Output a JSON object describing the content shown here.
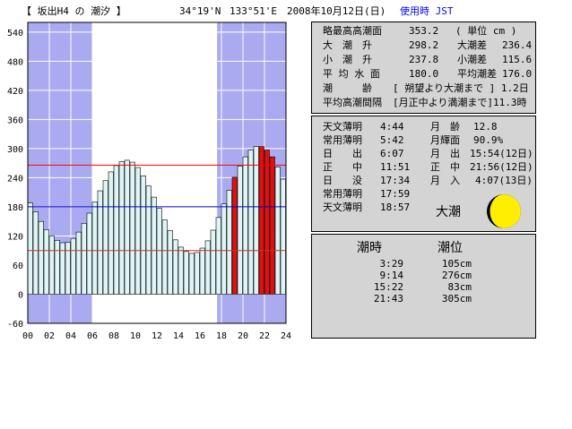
{
  "header": {
    "title": "【 坂出H4 の 潮汐 】",
    "lat": "34°19'N",
    "lon": "133°51'E",
    "date": "2008年10月12日(日)",
    "timezone": "使用時 JST"
  },
  "info": {
    "rows": [
      {
        "label": "略最高高潮面",
        "value": "353.2",
        "extra": "( 単位 cm )"
      },
      {
        "label": "大　潮　升",
        "value": "298.2",
        "label2": "大潮差",
        "value2": "236.4"
      },
      {
        "label": "小　潮　升",
        "value": "237.8",
        "label2": "小潮差",
        "value2": "115.6"
      },
      {
        "label": "平 均 水 面",
        "value": "180.0",
        "label2": "平均潮差",
        "value2": "176.0"
      },
      {
        "label": "潮　　　齢",
        "value": "[ 朔望より大潮まで ] 1.2日"
      },
      {
        "label": "平均高潮間隔",
        "value": "[月正中より満潮まで]11.3時"
      }
    ]
  },
  "astro": {
    "left": [
      {
        "label": "天文薄明",
        "value": "4:44"
      },
      {
        "label": "常用薄明",
        "value": "5:42"
      },
      {
        "label": "日　　出",
        "value": "6:07"
      },
      {
        "label": "正　　中",
        "value": "11:51"
      },
      {
        "label": "日　　没",
        "value": "17:34"
      },
      {
        "label": "常用薄明",
        "value": "17:59"
      },
      {
        "label": "天文薄明",
        "value": "18:57"
      }
    ],
    "right": [
      {
        "label": "月　齢",
        "value": "12.8"
      },
      {
        "label": "月輝面",
        "value": "90.9%"
      },
      {
        "label": "月　出",
        "value": "15:54(12日)"
      },
      {
        "label": "正　中",
        "value": "21:56(12日)"
      },
      {
        "label": "月　入",
        "value": "4:07(13日)"
      }
    ],
    "tide_type": "大潮",
    "moon_illumination": 0.909
  },
  "tides": {
    "header_time": "潮時",
    "header_level": "潮位",
    "rows": [
      {
        "time": "3:29",
        "level": "105cm"
      },
      {
        "time": "9:14",
        "level": "276cm"
      },
      {
        "time": "15:22",
        "level": "83cm"
      },
      {
        "time": "21:43",
        "level": "305cm"
      }
    ]
  },
  "colors": {
    "night": "#aaaaf0",
    "bar_fill": "#dff5f5",
    "bar_highlight": "#dd1111",
    "line_high": "#ff0000",
    "line_mean": "#0000cc",
    "line_low": "#cc3333",
    "moon": "#ffee00"
  },
  "chart_data": {
    "type": "bar",
    "xlabel": "",
    "ylabel": "",
    "xlim": [
      0,
      24
    ],
    "ylim": [
      -60,
      560
    ],
    "yticks": [
      -60,
      0,
      60,
      120,
      180,
      240,
      300,
      360,
      420,
      480,
      540
    ],
    "xticks": [
      "00",
      "02",
      "04",
      "06",
      "08",
      "10",
      "12",
      "14",
      "16",
      "18",
      "20",
      "22",
      "24"
    ],
    "night_ranges": [
      [
        0,
        6.0
      ],
      [
        17.6,
        24
      ]
    ],
    "hlines": [
      {
        "y": 266,
        "role": "high"
      },
      {
        "y": 180,
        "role": "mean"
      },
      {
        "y": 90,
        "role": "low"
      }
    ],
    "highlight_hours": [
      19.0,
      21.5,
      22.0,
      22.5
    ],
    "x": [
      0,
      0.5,
      1,
      1.5,
      2,
      2.5,
      3,
      3.5,
      4,
      4.5,
      5,
      5.5,
      6,
      6.5,
      7,
      7.5,
      8,
      8.5,
      9,
      9.5,
      10,
      10.5,
      11,
      11.5,
      12,
      12.5,
      13,
      13.5,
      14,
      14.5,
      15,
      15.5,
      16,
      16.5,
      17,
      17.5,
      18,
      18.5,
      19,
      19.5,
      20,
      20.5,
      21,
      21.5,
      22,
      22.5,
      23,
      23.5
    ],
    "values": [
      188,
      170,
      150,
      133,
      120,
      111,
      106,
      107,
      115,
      128,
      146,
      167,
      190,
      213,
      234,
      252,
      265,
      273,
      276,
      272,
      261,
      244,
      223,
      200,
      177,
      153,
      131,
      112,
      97,
      88,
      84,
      86,
      95,
      110,
      132,
      158,
      186,
      214,
      241,
      264,
      283,
      297,
      304,
      304,
      297,
      283,
      262,
      237
    ]
  }
}
